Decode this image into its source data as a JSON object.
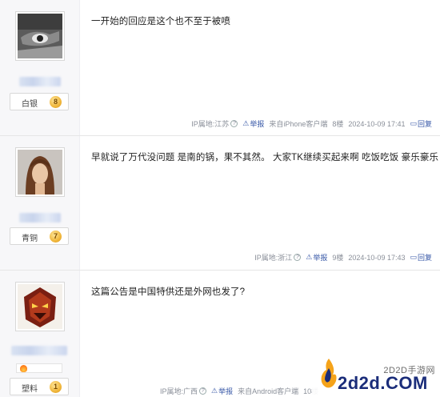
{
  "posts": [
    {
      "text": "一开始的回应是这个也不至于被喷",
      "level_name": "白银",
      "level": "8",
      "ip": "IP属地:江苏",
      "report": "举报",
      "client": "来自iPhone客户端",
      "floor": "8楼",
      "time": "2024-10-09 17:41",
      "reply": "回复"
    },
    {
      "text": "早就说了万代没问题 是南的锅，果不其然。 大家TK继续买起来啊 吃饭吃饭 豪乐豪乐",
      "level_name": "青铜",
      "level": "7",
      "ip": "IP属地:浙江",
      "report": "举报",
      "floor": "9楼",
      "time": "2024-10-09 17:43",
      "reply": "回复"
    },
    {
      "text": "这篇公告是中国特供还是外网也发了?",
      "level_name": "塑料",
      "level": "1",
      "ip": "IP属地:广西",
      "report": "举报",
      "client": "来自Android客户端",
      "floor": "10楼"
    }
  ],
  "watermark": {
    "site_name": "2D2D手游网",
    "domain": "2d2d.COM"
  },
  "icons": [
    "help-circle-icon",
    "warning-triangle-icon",
    "reply-icon",
    "level-coin-icon",
    "flame-badge-icon"
  ],
  "colors": {
    "link": "#3a5aa8",
    "meta": "#8a8f99",
    "sidebar": "#f7f7f9",
    "watermark": "#1b2d7a"
  }
}
